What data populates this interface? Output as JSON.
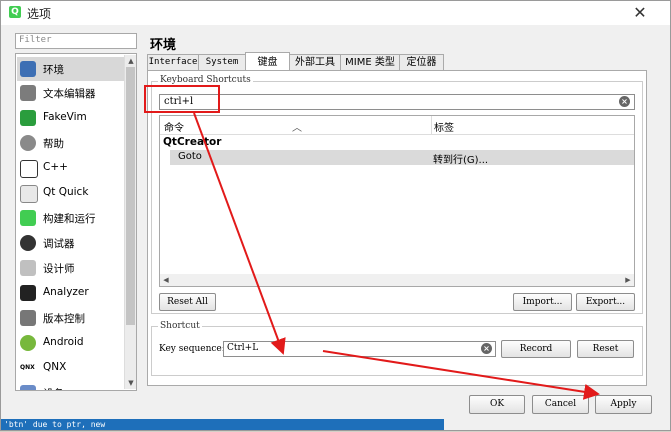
{
  "window": {
    "title": "选项",
    "logo": "Q"
  },
  "filter": {
    "placeholder": "Filter"
  },
  "categories": [
    {
      "label": "环境",
      "icon": "environment-icon"
    },
    {
      "label": "文本编辑器",
      "icon": "text-editor-icon"
    },
    {
      "label": "FakeVim",
      "icon": "fakevim-icon"
    },
    {
      "label": "帮助",
      "icon": "help-icon"
    },
    {
      "label": "C++",
      "icon": "cpp-icon"
    },
    {
      "label": "Qt Quick",
      "icon": "qt-quick-icon"
    },
    {
      "label": "构建和运行",
      "icon": "build-run-icon"
    },
    {
      "label": "调试器",
      "icon": "debugger-icon"
    },
    {
      "label": "设计师",
      "icon": "designer-icon"
    },
    {
      "label": "Analyzer",
      "icon": "analyzer-icon"
    },
    {
      "label": "版本控制",
      "icon": "version-control-icon"
    },
    {
      "label": "Android",
      "icon": "android-icon"
    },
    {
      "label": "QNX",
      "icon": "qnx-icon",
      "logo_text": "QNX"
    },
    {
      "label": "设备",
      "icon": "devices-icon"
    }
  ],
  "selected_category": "环境",
  "panel": {
    "title": "环境"
  },
  "tabs": [
    "Interface",
    "System",
    "键盘",
    "外部工具",
    "MIME 类型",
    "定位器"
  ],
  "active_tab": "键盘",
  "shortcuts": {
    "group_label": "Keyboard Shortcuts",
    "search_value": "ctrl+l",
    "columns": [
      "命令",
      "标签"
    ],
    "tree": {
      "group": "QtCreator",
      "rows": [
        {
          "command": "Goto",
          "label": "转到行(G)..."
        }
      ]
    },
    "reset_all": "Reset All",
    "import": "Import...",
    "export": "Export..."
  },
  "shortcut": {
    "group_label": "Shortcut",
    "key_sequence_label": "Key sequence:",
    "key_sequence_value": "Ctrl+L",
    "record": "Record",
    "reset": "Reset"
  },
  "footer": {
    "ok": "OK",
    "cancel": "Cancel",
    "apply": "Apply"
  },
  "status": {
    "text": "'btn' due to ptr, new"
  },
  "colors": {
    "annotation_red": "#e21a1a",
    "selection_gray": "#d8d8d8"
  }
}
